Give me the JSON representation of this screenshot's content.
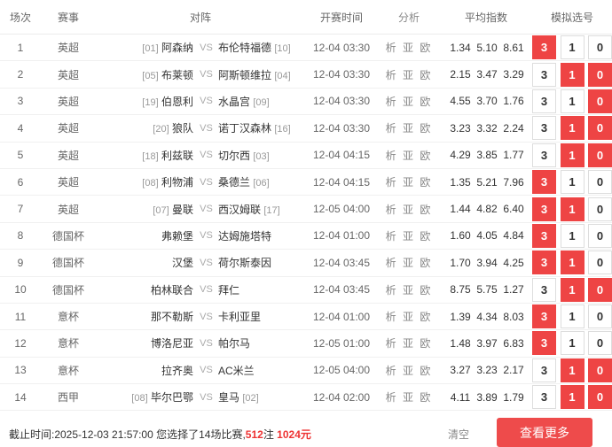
{
  "header": {
    "no": "场次",
    "league": "赛事",
    "match": "对阵",
    "time": "开赛时间",
    "analysis": "分析",
    "odds": "平均指数",
    "select": "模拟选号"
  },
  "analysis_label": "析 亚 欧",
  "vs_label": "VS",
  "rows": [
    {
      "no": "1",
      "league": "英超",
      "home_rank": "[01]",
      "home": "阿森纳",
      "away": "布伦特福德",
      "away_rank": "[10]",
      "time": "12-04 03:30",
      "o1": "1.34",
      "o2": "5.10",
      "o3": "8.61",
      "b3": "3",
      "b1": "1",
      "b0": "0",
      "sel": [
        true,
        false,
        false
      ]
    },
    {
      "no": "2",
      "league": "英超",
      "home_rank": "[05]",
      "home": "布莱顿",
      "away": "阿斯顿维拉",
      "away_rank": "[04]",
      "time": "12-04 03:30",
      "o1": "2.15",
      "o2": "3.47",
      "o3": "3.29",
      "b3": "3",
      "b1": "1",
      "b0": "0",
      "sel": [
        false,
        true,
        true
      ]
    },
    {
      "no": "3",
      "league": "英超",
      "home_rank": "[19]",
      "home": "伯恩利",
      "away": "水晶宫",
      "away_rank": "[09]",
      "time": "12-04 03:30",
      "o1": "4.55",
      "o2": "3.70",
      "o3": "1.76",
      "b3": "3",
      "b1": "1",
      "b0": "0",
      "sel": [
        false,
        false,
        true
      ]
    },
    {
      "no": "4",
      "league": "英超",
      "home_rank": "[20]",
      "home": "狼队",
      "away": "诺丁汉森林",
      "away_rank": "[16]",
      "time": "12-04 03:30",
      "o1": "3.23",
      "o2": "3.32",
      "o3": "2.24",
      "b3": "3",
      "b1": "1",
      "b0": "0",
      "sel": [
        false,
        true,
        true
      ]
    },
    {
      "no": "5",
      "league": "英超",
      "home_rank": "[18]",
      "home": "利兹联",
      "away": "切尔西",
      "away_rank": "[03]",
      "time": "12-04 04:15",
      "o1": "4.29",
      "o2": "3.85",
      "o3": "1.77",
      "b3": "3",
      "b1": "1",
      "b0": "0",
      "sel": [
        false,
        true,
        true
      ]
    },
    {
      "no": "6",
      "league": "英超",
      "home_rank": "[08]",
      "home": "利物浦",
      "away": "桑德兰",
      "away_rank": "[06]",
      "time": "12-04 04:15",
      "o1": "1.35",
      "o2": "5.21",
      "o3": "7.96",
      "b3": "3",
      "b1": "1",
      "b0": "0",
      "sel": [
        true,
        false,
        false
      ]
    },
    {
      "no": "7",
      "league": "英超",
      "home_rank": "[07]",
      "home": "曼联",
      "away": "西汉姆联",
      "away_rank": "[17]",
      "time": "12-05 04:00",
      "o1": "1.44",
      "o2": "4.82",
      "o3": "6.40",
      "b3": "3",
      "b1": "1",
      "b0": "0",
      "sel": [
        true,
        true,
        false
      ]
    },
    {
      "no": "8",
      "league": "德国杯",
      "home_rank": "",
      "home": "弗赖堡",
      "away": "达姆施塔特",
      "away_rank": "",
      "time": "12-04 01:00",
      "o1": "1.60",
      "o2": "4.05",
      "o3": "4.84",
      "b3": "3",
      "b1": "1",
      "b0": "0",
      "sel": [
        true,
        false,
        false
      ]
    },
    {
      "no": "9",
      "league": "德国杯",
      "home_rank": "",
      "home": "汉堡",
      "away": "荷尔斯泰因",
      "away_rank": "",
      "time": "12-04 03:45",
      "o1": "1.70",
      "o2": "3.94",
      "o3": "4.25",
      "b3": "3",
      "b1": "1",
      "b0": "0",
      "sel": [
        true,
        true,
        false
      ]
    },
    {
      "no": "10",
      "league": "德国杯",
      "home_rank": "",
      "home": "柏林联合",
      "away": "拜仁",
      "away_rank": "",
      "time": "12-04 03:45",
      "o1": "8.75",
      "o2": "5.75",
      "o3": "1.27",
      "b3": "3",
      "b1": "1",
      "b0": "0",
      "sel": [
        false,
        true,
        true
      ]
    },
    {
      "no": "11",
      "league": "意杯",
      "home_rank": "",
      "home": "那不勒斯",
      "away": "卡利亚里",
      "away_rank": "",
      "time": "12-04 01:00",
      "o1": "1.39",
      "o2": "4.34",
      "o3": "8.03",
      "b3": "3",
      "b1": "1",
      "b0": "0",
      "sel": [
        true,
        false,
        false
      ]
    },
    {
      "no": "12",
      "league": "意杯",
      "home_rank": "",
      "home": "博洛尼亚",
      "away": "帕尔马",
      "away_rank": "",
      "time": "12-05 01:00",
      "o1": "1.48",
      "o2": "3.97",
      "o3": "6.83",
      "b3": "3",
      "b1": "1",
      "b0": "0",
      "sel": [
        true,
        false,
        false
      ]
    },
    {
      "no": "13",
      "league": "意杯",
      "home_rank": "",
      "home": "拉齐奥",
      "away": "AC米兰",
      "away_rank": "",
      "time": "12-05 04:00",
      "o1": "3.27",
      "o2": "3.23",
      "o3": "2.17",
      "b3": "3",
      "b1": "1",
      "b0": "0",
      "sel": [
        false,
        true,
        true
      ]
    },
    {
      "no": "14",
      "league": "西甲",
      "home_rank": "[08]",
      "home": "毕尔巴鄂",
      "away": "皇马",
      "away_rank": "[02]",
      "time": "12-04 02:00",
      "o1": "4.11",
      "o2": "3.89",
      "o3": "1.79",
      "b3": "3",
      "b1": "1",
      "b0": "0",
      "sel": [
        false,
        true,
        true
      ]
    }
  ],
  "footer": {
    "deadline": "截止时间:2025-12-03 21:57:00 您选择了14场比赛,",
    "bets": "512",
    "bets_unit": "注",
    "amount": "1024元",
    "clear_label": "清空",
    "more_label": "查看更多"
  },
  "colors": {
    "accent": "#ee4444",
    "more_button": "#ee4b4b"
  }
}
